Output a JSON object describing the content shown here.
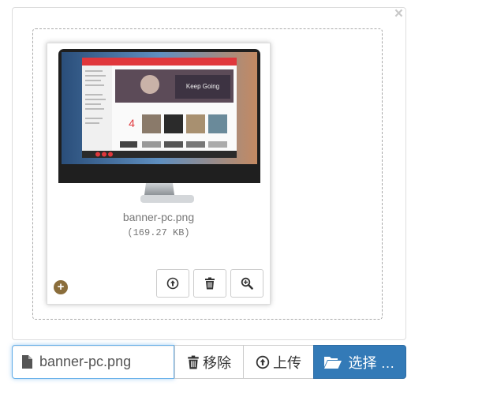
{
  "preview": {
    "close_symbol": "×",
    "file": {
      "name": "banner-pc.png",
      "size": "(169.27 KB)",
      "thumbnail": {
        "app_banner_text": "Keep Going",
        "date_number": "4"
      }
    },
    "actions": [
      {
        "icon": "upload-icon"
      },
      {
        "icon": "trash-icon"
      },
      {
        "icon": "zoom-in-icon"
      }
    ]
  },
  "toolbar": {
    "caption_value": "banner-pc.png",
    "remove_label": "移除",
    "upload_label": "上传",
    "browse_label": "选择 …"
  },
  "colors": {
    "primary": "#337ab7",
    "app_red": "#e0373c",
    "focus_border": "#66afe9",
    "plus_icon": "#8a6d3b"
  }
}
